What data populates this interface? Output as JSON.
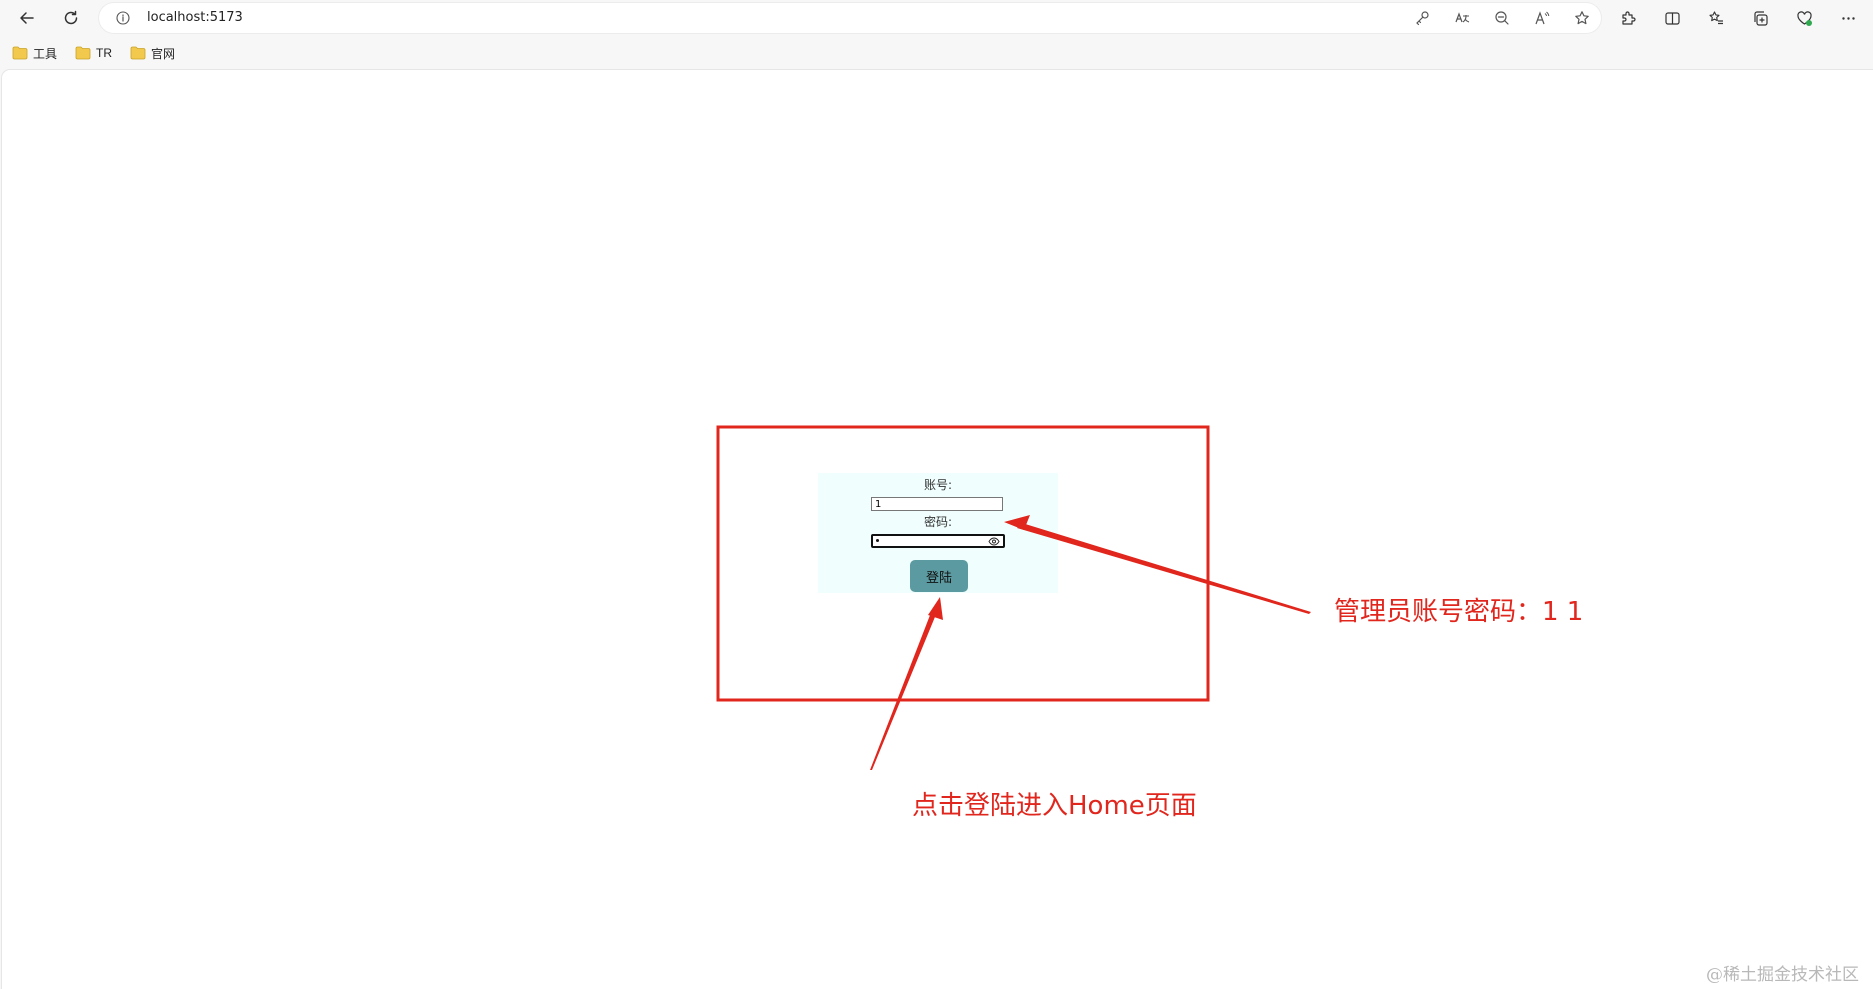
{
  "browser": {
    "url": "localhost:5173",
    "bookmarks": [
      {
        "label": "工具",
        "icon": "folder-icon"
      },
      {
        "label": "TR",
        "icon": "folder-icon"
      },
      {
        "label": "官网",
        "icon": "folder-icon"
      }
    ],
    "colors": {
      "folder": "#f2c94c",
      "chrome": "#f7f7f7"
    }
  },
  "login": {
    "account_label": "账号:",
    "account_value": "1",
    "password_label": "密码:",
    "button_label": "登陆",
    "colors": {
      "box_bg": "#f0fffe",
      "button_bg": "#5b9aa0"
    }
  },
  "annotations": {
    "admin_credentials": "管理员账号密码：1 1",
    "click_hint": "点击登陆进入Home页面",
    "color": "#e0261d"
  },
  "watermark": "@稀土掘金技术社区"
}
